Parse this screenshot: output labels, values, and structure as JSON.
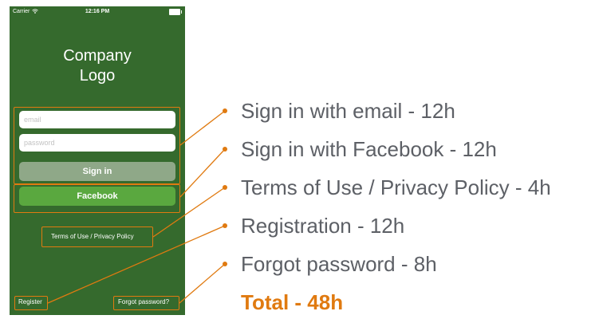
{
  "status_bar": {
    "carrier": "Carrier",
    "time": "12:16 PM",
    "wifi_icon": "wifi-icon",
    "battery_icon": "battery-icon"
  },
  "login_screen": {
    "logo_line1": "Company",
    "logo_line2": "Logo",
    "email_placeholder": "email",
    "password_placeholder": "password",
    "signin_label": "Sign in",
    "facebook_label": "Facebook",
    "terms_link": "Terms of Use / Privacy Policy",
    "register_link": "Register",
    "forgot_link": "Forgot password?"
  },
  "estimates": [
    {
      "label": "Sign in with email - 12h"
    },
    {
      "label": "Sign in with Facebook - 12h"
    },
    {
      "label": "Terms of Use / Privacy Policy - 4h"
    },
    {
      "label": "Registration - 12h"
    },
    {
      "label": "Forgot password - 8h"
    }
  ],
  "total": "Total - 48h",
  "colors": {
    "background": "#356a2d",
    "highlight": "#e07a10",
    "facebook_button": "#5aa83f",
    "signin_button": "#8fa888",
    "label_text": "#5d6066"
  }
}
